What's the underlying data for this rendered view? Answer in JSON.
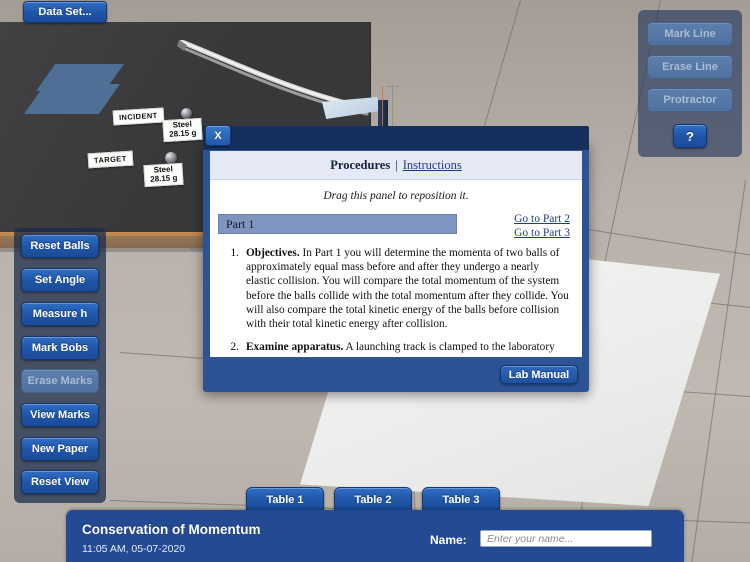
{
  "app": {
    "dataset_button": "Data Set...",
    "help_button": "?"
  },
  "apparatus": {
    "incident_label": "INCIDENT",
    "target_label": "TARGET",
    "incident_mass": "Steel\n28.15 g",
    "incident_mass_line1": "Steel",
    "incident_mass_line2": "28.15 g",
    "target_mass_line1": "Steel",
    "target_mass_line2": "28.15 g"
  },
  "left_panel": {
    "items": [
      {
        "label": "Reset Balls",
        "disabled": false
      },
      {
        "label": "Set Angle",
        "disabled": false
      },
      {
        "label": "Measure h",
        "disabled": false
      },
      {
        "label": "Mark Bobs",
        "disabled": false
      },
      {
        "label": "Erase Marks",
        "disabled": true
      },
      {
        "label": "View Marks",
        "disabled": false
      },
      {
        "label": "New Paper",
        "disabled": false
      },
      {
        "label": "Reset View",
        "disabled": false
      }
    ]
  },
  "right_panel": {
    "items": [
      {
        "label": "Mark Line",
        "disabled": true
      },
      {
        "label": "Erase Line",
        "disabled": true
      },
      {
        "label": "Protractor",
        "disabled": true
      }
    ]
  },
  "dialog": {
    "close_label": "X",
    "title": "Procedures",
    "separator": "|",
    "instructions_link": "Instructions",
    "drag_hint": "Drag this panel to reposition it.",
    "part_selected": "Part 1",
    "goto_links": [
      "Go to Part 2",
      "Go to Part 3"
    ],
    "items": [
      {
        "number": "1.",
        "heading": "Objectives.",
        "body": "In Part 1 you will determine the momenta of two balls of approximately equal mass before and after they undergo a nearly elastic collision. You will compare the total momentum of the system before the balls collide with the total momentum after they collide. You will also compare the total kinetic energy of the balls before collision with their total kinetic energy after collision."
      },
      {
        "number": "2.",
        "heading": "Examine apparatus.",
        "body": "A launching track is clamped to the laboratory"
      }
    ],
    "lab_manual_button": "Lab Manual"
  },
  "bottom": {
    "tabs": [
      "Table 1",
      "Table 2",
      "Table 3"
    ],
    "title": "Conservation of Momentum",
    "timestamp": "11:05 AM, 05-07-2020",
    "name_label": "Name:",
    "name_value": "",
    "name_placeholder": "Enter your name..."
  },
  "colors": {
    "accent_blue": "#1f55a8",
    "panel_blue": "#244a93",
    "titlebar_blue": "#16305e",
    "carbon_paper": "#4e6f96",
    "table_dark": "#38383a"
  }
}
